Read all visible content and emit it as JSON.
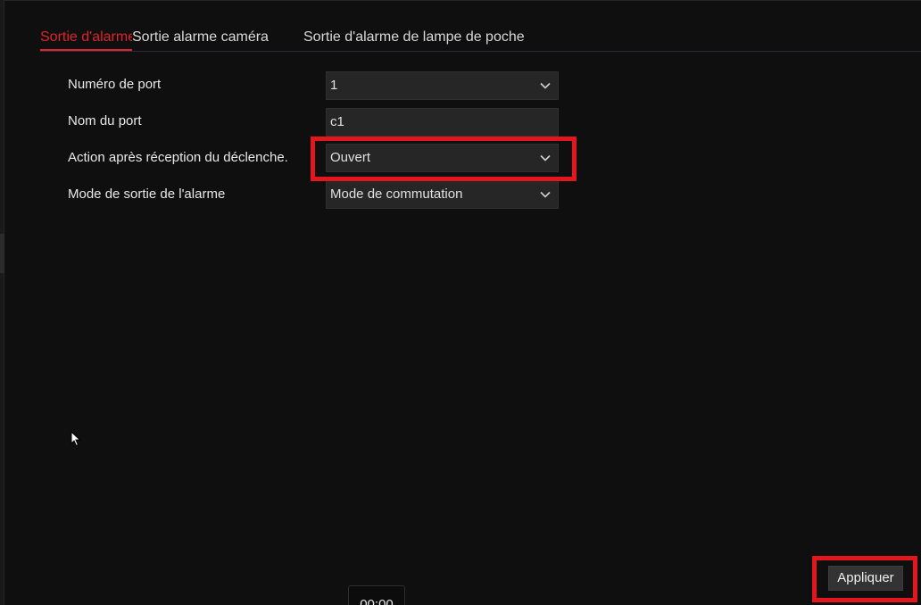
{
  "tabs": [
    {
      "label": "Sortie d'alarme",
      "active": true
    },
    {
      "label": "Sortie alarme caméra",
      "active": false
    },
    {
      "label": "Sortie d'alarme de lampe de poche",
      "active": false
    }
  ],
  "form": {
    "port_number": {
      "label": "Numéro de port",
      "value": "1"
    },
    "port_name": {
      "label": "Nom du port",
      "value": "c1"
    },
    "trigger_action": {
      "label": "Action après réception du déclenche.",
      "value": "Ouvert"
    },
    "output_mode": {
      "label": "Mode de sortie de l'alarme",
      "value": "Mode de commutation"
    }
  },
  "actions": {
    "apply_label": "Appliquer"
  },
  "timeline": {
    "time_label": "00:00"
  },
  "colors": {
    "accent": "#e0242b",
    "highlight": "#e3161d",
    "background": "#0f0f0f",
    "field": "#262626"
  },
  "icons": {
    "dropdown": "chevron-down-icon",
    "pointer": "mouse-cursor-icon"
  }
}
